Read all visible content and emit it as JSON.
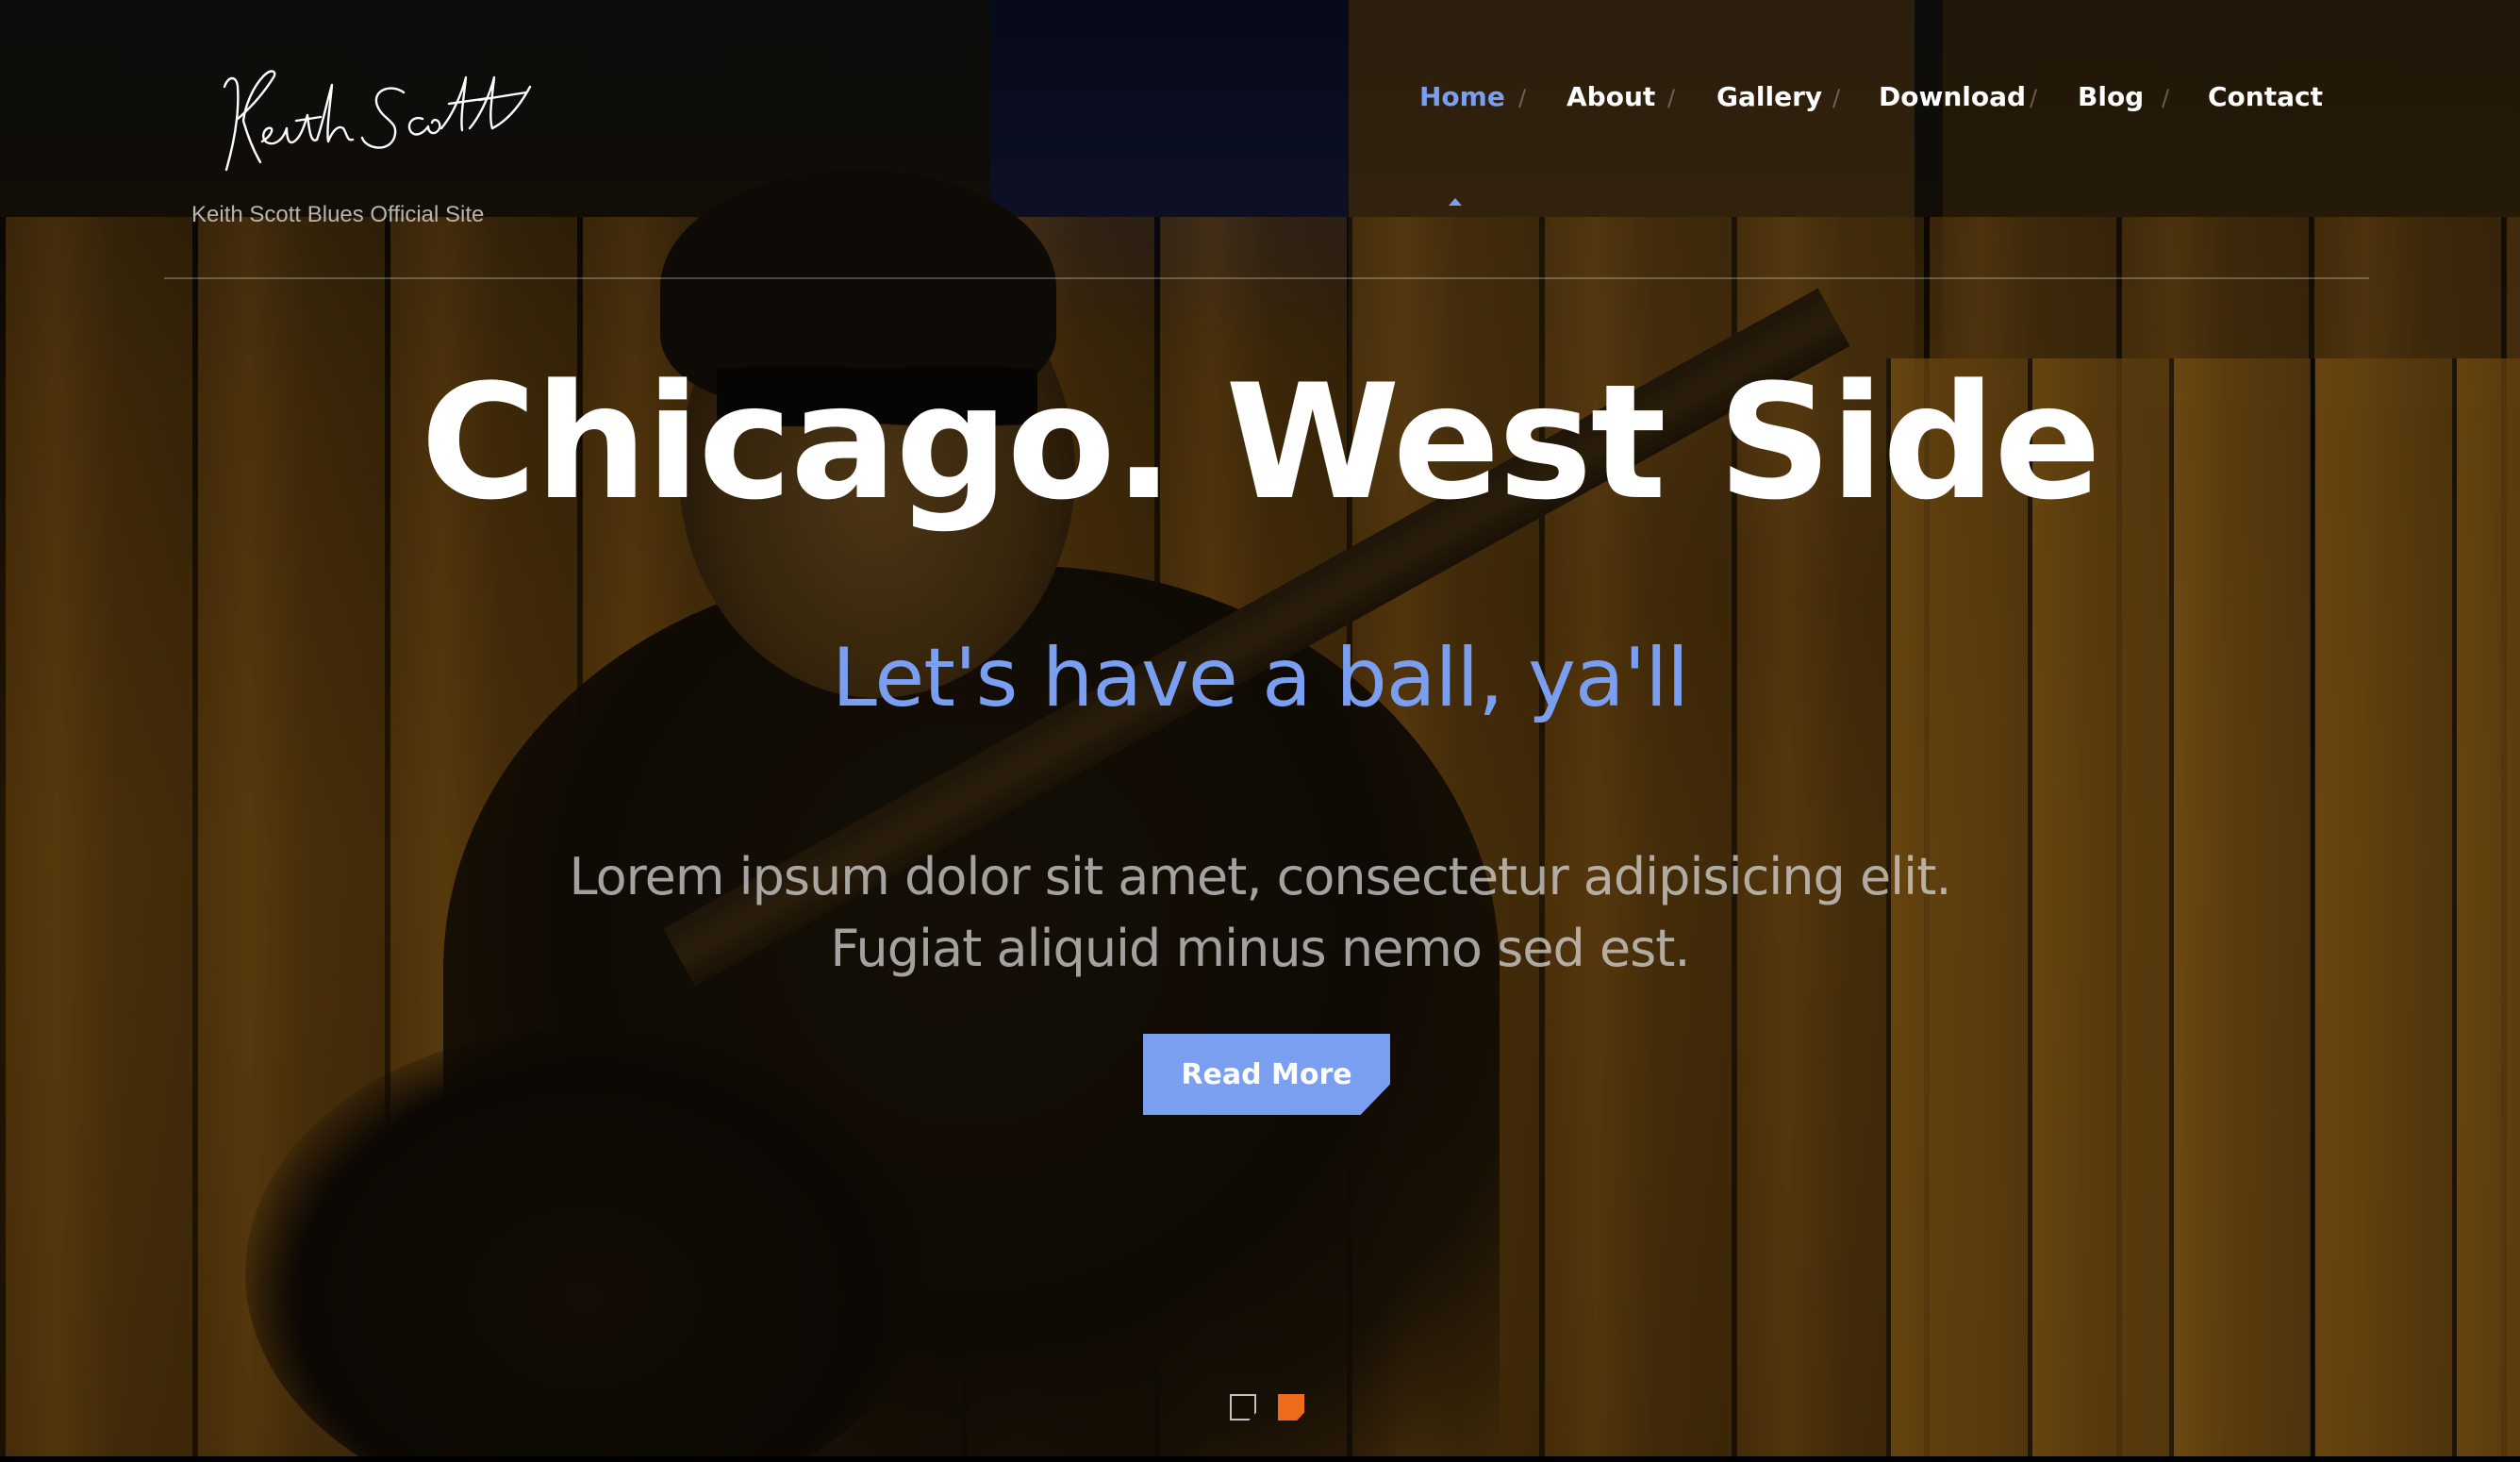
{
  "header": {
    "logo_alt": "Keith Scott",
    "tagline": "Keith Scott Blues Official Site"
  },
  "nav": {
    "items": [
      {
        "label": "Home",
        "active": true
      },
      {
        "label": "About",
        "active": false
      },
      {
        "label": "Gallery",
        "active": false
      },
      {
        "label": "Download",
        "active": false
      },
      {
        "label": "Blog",
        "active": false
      },
      {
        "label": "Contact",
        "active": false
      }
    ],
    "separator": "/"
  },
  "hero": {
    "title": "Chicago. West Side",
    "subtitle": "Let's have a ball, ya'll",
    "body_line1": "Lorem ipsum dolor sit amet, consectetur adipisicing elit.",
    "body_line2": "Fugiat aliquid minus nemo sed est.",
    "cta_label": "Read More"
  },
  "slider": {
    "slide_count": 2,
    "active_index": 1
  },
  "colors": {
    "accent": "#7a9ff0",
    "active_dot": "#f06a1e",
    "text": "#ffffff"
  }
}
